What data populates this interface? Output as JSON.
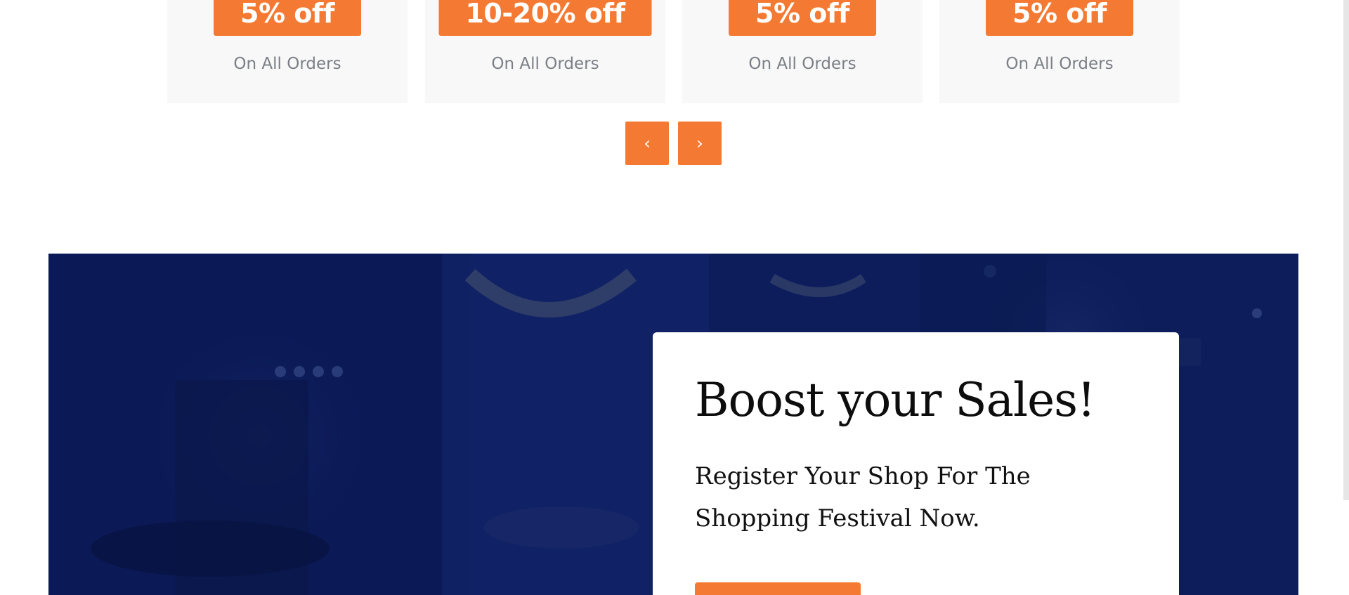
{
  "offers": [
    {
      "discount": "5% off",
      "caption": "On All Orders"
    },
    {
      "discount": "10-20% off",
      "caption": "On All Orders"
    },
    {
      "discount": "5% off",
      "caption": "On All Orders"
    },
    {
      "discount": "5% off",
      "caption": "On All Orders"
    }
  ],
  "slider": {
    "prev_icon": "‹",
    "next_icon": "›"
  },
  "banner": {
    "title": "Boost your Sales!",
    "text": "Register Your Shop For The Shopping Festival Now.",
    "cta_label": ""
  },
  "colors": {
    "accent": "#f47a33",
    "banner_overlay": "#0d1d5c",
    "card_bg": "#f8f8f8",
    "caption": "#7b7f86"
  }
}
